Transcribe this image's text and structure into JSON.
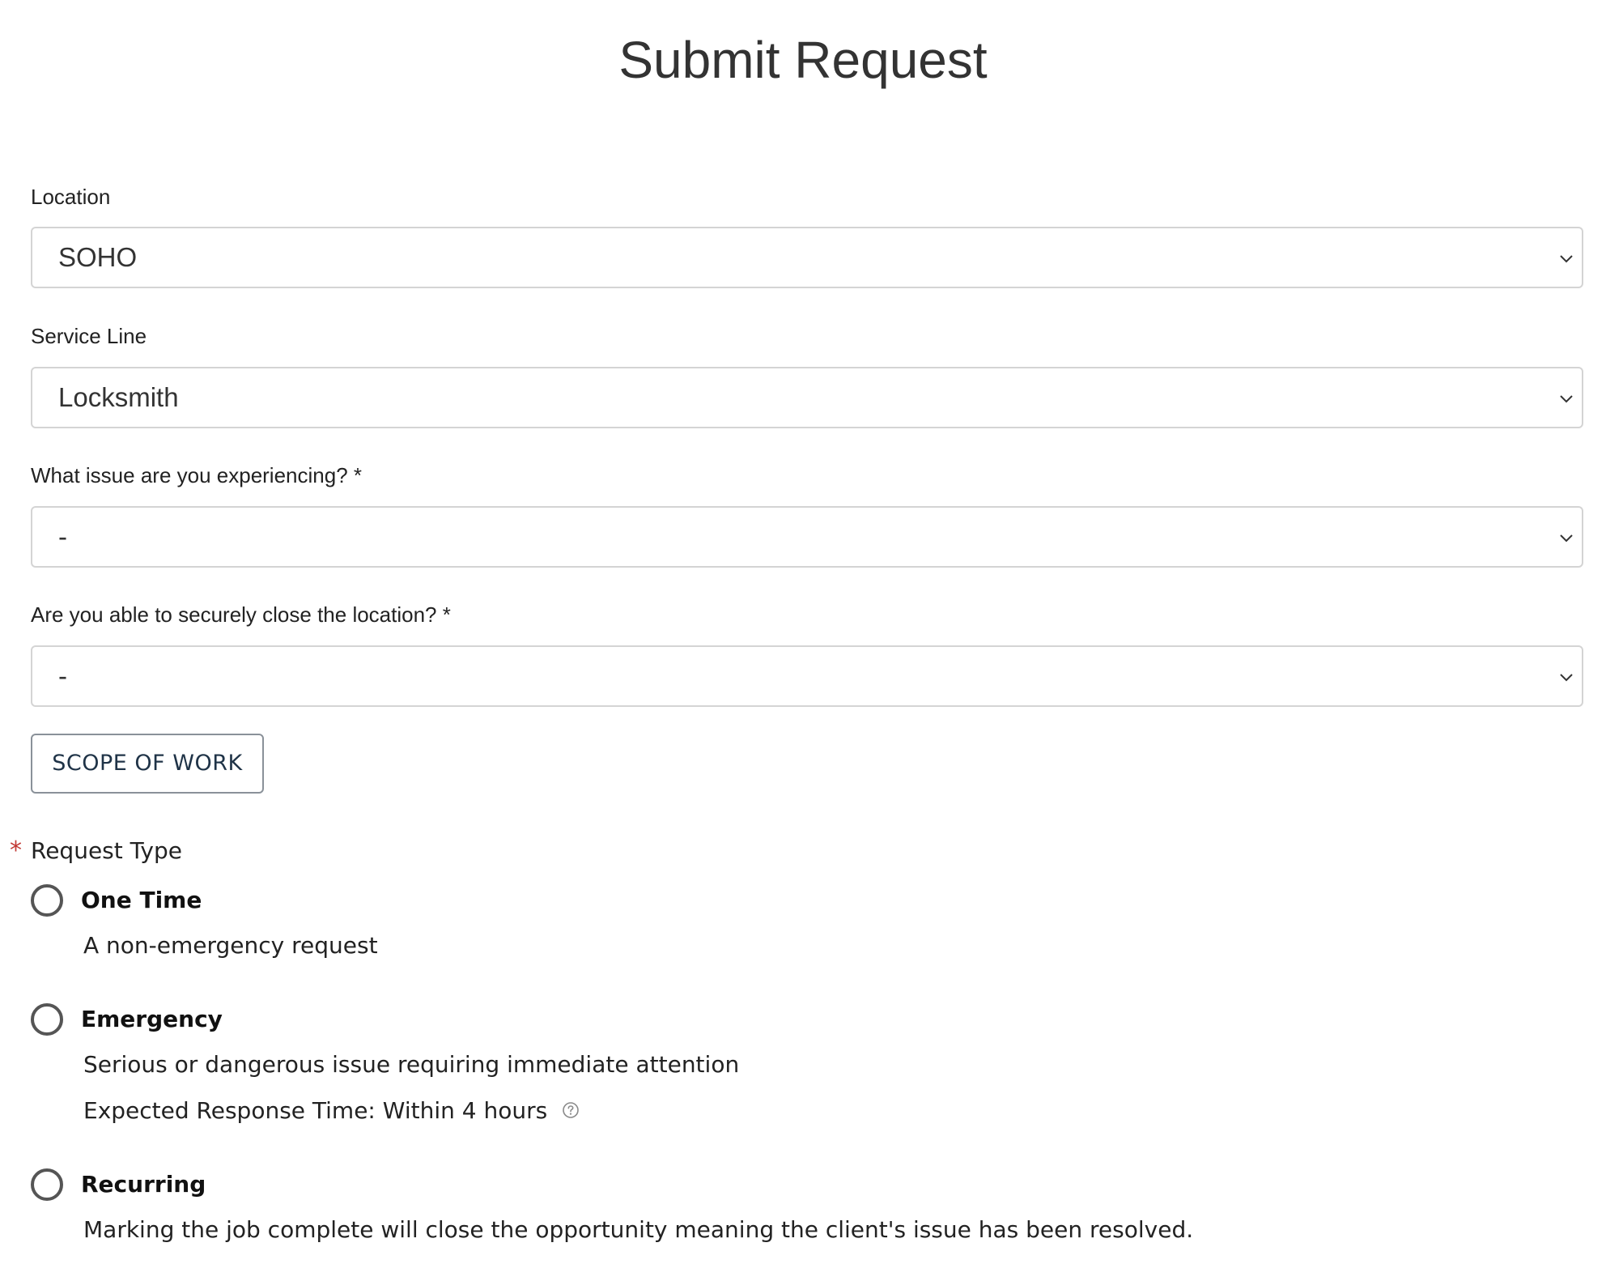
{
  "page": {
    "title": "Submit Request"
  },
  "form": {
    "location": {
      "label": "Location",
      "value": "SOHO"
    },
    "service_line": {
      "label": "Service Line",
      "value": "Locksmith"
    },
    "issue": {
      "label": "What issue are you experiencing? *",
      "value": "-"
    },
    "secure_close": {
      "label": "Are you able to securely close the location? *",
      "value": "-"
    },
    "scope_button_label": "SCOPE OF WORK",
    "request_type": {
      "required_marker": "*",
      "label": "Request Type",
      "options": [
        {
          "title": "One Time",
          "description": "A non-emergency request",
          "selected": false
        },
        {
          "title": "Emergency",
          "description": "Serious or dangerous issue requiring immediate attention",
          "response_time": "Expected Response Time: Within 4 hours",
          "help_icon": "question-circle-icon",
          "selected": false
        },
        {
          "title": "Recurring",
          "description": "Marking the job complete will close the opportunity meaning the client's issue has been resolved.",
          "selected": false
        }
      ]
    }
  },
  "colors": {
    "required_star": "#c23934",
    "button_text": "#1f3347",
    "border": "#d4d4d4"
  }
}
